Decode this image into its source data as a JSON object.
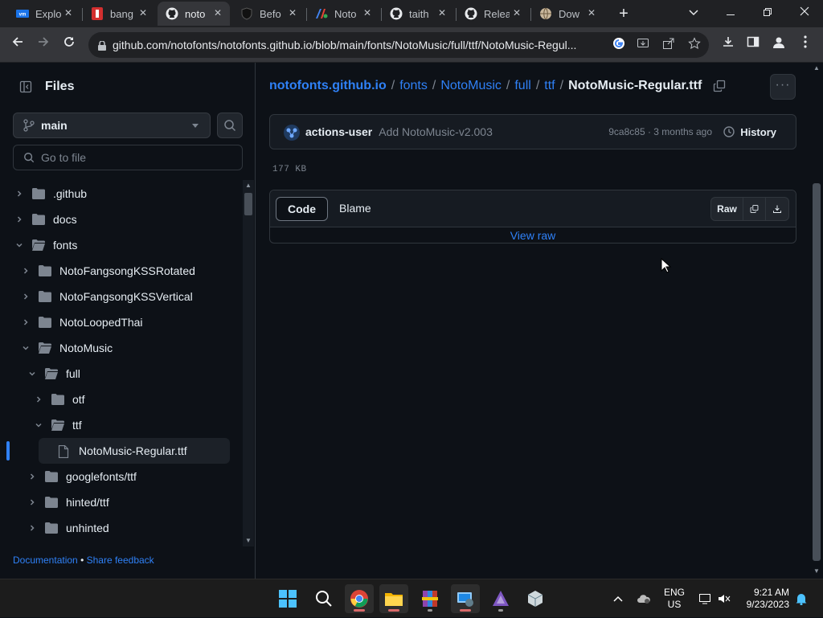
{
  "browser": {
    "tabs": [
      {
        "title": "Explo",
        "icon": "vmware-icon"
      },
      {
        "title": "bang",
        "icon": "red-site-icon"
      },
      {
        "title": "noto",
        "icon": "github-icon",
        "active": true
      },
      {
        "title": "Befo",
        "icon": "shield-icon"
      },
      {
        "title": "Noto",
        "icon": "google-fonts-icon"
      },
      {
        "title": "taith",
        "icon": "github-icon"
      },
      {
        "title": "Relea",
        "icon": "github-icon"
      },
      {
        "title": "Dow",
        "icon": "globe-icon"
      }
    ],
    "url": "github.com/notofonts/notofonts.github.io/blob/main/fonts/NotoMusic/full/ttf/NotoMusic-Regul..."
  },
  "sidebar": {
    "title": "Files",
    "branch": "main",
    "goto_placeholder": "Go to file",
    "tree": [
      {
        "label": ".github",
        "type": "folder",
        "depth": 0,
        "expanded": false
      },
      {
        "label": "docs",
        "type": "folder",
        "depth": 0,
        "expanded": false
      },
      {
        "label": "fonts",
        "type": "folder",
        "depth": 0,
        "expanded": true
      },
      {
        "label": "NotoFangsongKSSRotated",
        "type": "folder",
        "depth": 1,
        "expanded": false
      },
      {
        "label": "NotoFangsongKSSVertical",
        "type": "folder",
        "depth": 1,
        "expanded": false
      },
      {
        "label": "NotoLoopedThai",
        "type": "folder",
        "depth": 1,
        "expanded": false
      },
      {
        "label": "NotoMusic",
        "type": "folder",
        "depth": 1,
        "expanded": true
      },
      {
        "label": "full",
        "type": "folder",
        "depth": 2,
        "expanded": true
      },
      {
        "label": "otf",
        "type": "folder",
        "depth": 3,
        "expanded": false
      },
      {
        "label": "ttf",
        "type": "folder",
        "depth": 3,
        "expanded": true
      },
      {
        "label": "NotoMusic-Regular.ttf",
        "type": "file",
        "depth": 4,
        "selected": true
      },
      {
        "label": "googlefonts/ttf",
        "type": "folder",
        "depth": 2,
        "expanded": false
      },
      {
        "label": "hinted/ttf",
        "type": "folder",
        "depth": 2,
        "expanded": false
      },
      {
        "label": "unhinted",
        "type": "folder",
        "depth": 2,
        "expanded": false
      }
    ],
    "footer": {
      "documentation": "Documentation",
      "separator": "•",
      "feedback": "Share feedback"
    }
  },
  "main": {
    "breadcrumb": {
      "root": "notofonts.github.io",
      "parts": [
        "fonts",
        "NotoMusic",
        "full",
        "ttf"
      ],
      "current": "NotoMusic-Regular.ttf",
      "sep": "/"
    },
    "more_label": "···",
    "commit": {
      "author": "actions-user",
      "message": "Add NotoMusic-v2.003",
      "meta": "9ca8c85 · 3 months ago",
      "history": "History"
    },
    "file_size": "177 KB",
    "tabs": {
      "code": "Code",
      "blame": "Blame"
    },
    "raw": "Raw",
    "view_raw": "View raw"
  },
  "taskbar": {
    "lang_line1": "ENG",
    "lang_line2": "US",
    "time": "9:21 AM",
    "date": "9/23/2023"
  },
  "colors": {
    "accent": "#2f81f7",
    "bg": "#0d1117",
    "border": "#30363d"
  }
}
